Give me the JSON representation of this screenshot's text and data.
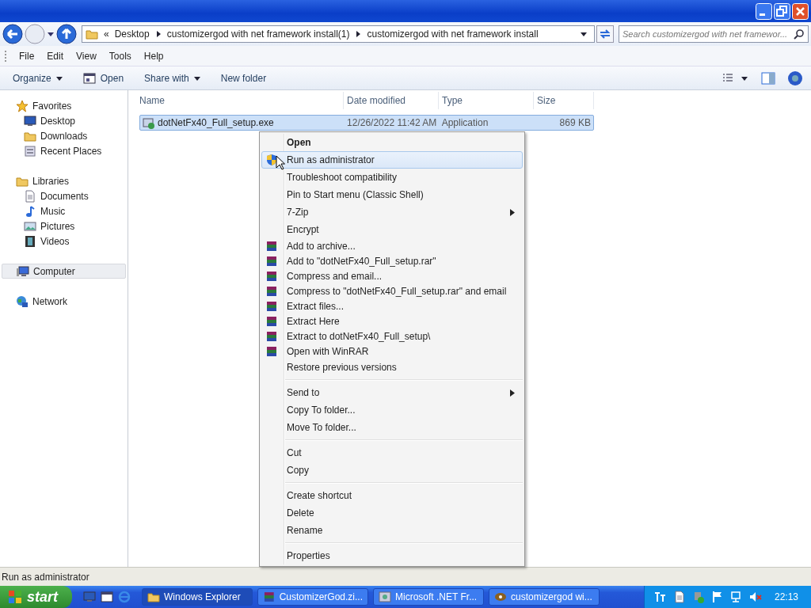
{
  "address_bar": {
    "overflow": "«",
    "crumbs": [
      "Desktop",
      "customizergod with net framework install(1)",
      "customizergod with net framework install"
    ]
  },
  "search": {
    "placeholder": "Search customizergod with net framewor..."
  },
  "menu_bar": [
    "File",
    "Edit",
    "View",
    "Tools",
    "Help"
  ],
  "command_bar": [
    {
      "label": "Organize",
      "kind": "dropdown"
    },
    {
      "label": "Open",
      "kind": "open"
    },
    {
      "label": "Share with",
      "kind": "dropdown"
    },
    {
      "label": "New folder",
      "kind": "plain"
    }
  ],
  "navigation": [
    {
      "label": "Favorites",
      "selected": false,
      "children": [
        {
          "label": "Desktop",
          "selected": false
        },
        {
          "label": "Downloads",
          "selected": false
        },
        {
          "label": "Recent Places",
          "selected": false
        }
      ]
    },
    {
      "label": "Libraries",
      "selected": false,
      "children": [
        {
          "label": "Documents",
          "selected": false
        },
        {
          "label": "Music",
          "selected": false
        },
        {
          "label": "Pictures",
          "selected": false
        },
        {
          "label": "Videos",
          "selected": false
        }
      ]
    },
    {
      "label": "Computer",
      "selected": true
    },
    {
      "label": "Network",
      "selected": false
    }
  ],
  "file_list": {
    "columns": [
      "Name",
      "Date modified",
      "Type",
      "Size"
    ],
    "rows": [
      {
        "name": "dotNetFx40_Full_setup.exe",
        "date_modified": "12/26/2022 11:42 AM",
        "type": "Application",
        "size": "869 KB",
        "selected": true
      }
    ]
  },
  "context_menu": [
    {
      "kind": "plain",
      "label": "Open",
      "default": true,
      "submenu": false,
      "selected": false
    },
    {
      "kind": "shield",
      "label": "Run as administrator",
      "default": false,
      "submenu": false,
      "selected": true
    },
    {
      "kind": "plain",
      "label": "Troubleshoot compatibility",
      "default": false,
      "submenu": false,
      "selected": false
    },
    {
      "kind": "plain",
      "label": "Pin to Start menu (Classic Shell)",
      "default": false,
      "submenu": false,
      "selected": false
    },
    {
      "kind": "plain",
      "label": "7-Zip",
      "default": false,
      "submenu": true,
      "selected": false
    },
    {
      "kind": "plain",
      "label": "Encrypt",
      "default": false,
      "submenu": false,
      "selected": false
    },
    {
      "kind": "archive",
      "label": "Add to archive...",
      "default": false,
      "submenu": false,
      "selected": false
    },
    {
      "kind": "archive",
      "label": "Add to \"dotNetFx40_Full_setup.rar\"",
      "default": false,
      "submenu": false,
      "selected": false
    },
    {
      "kind": "archive",
      "label": "Compress and email...",
      "default": false,
      "submenu": false,
      "selected": false
    },
    {
      "kind": "archive",
      "label": "Compress to \"dotNetFx40_Full_setup.rar\" and email",
      "default": false,
      "submenu": false,
      "selected": false
    },
    {
      "kind": "archive",
      "label": "Extract files...",
      "default": false,
      "submenu": false,
      "selected": false
    },
    {
      "kind": "archive",
      "label": "Extract Here",
      "default": false,
      "submenu": false,
      "selected": false
    },
    {
      "kind": "archive",
      "label": "Extract to dotNetFx40_Full_setup\\",
      "default": false,
      "submenu": false,
      "selected": false
    },
    {
      "kind": "archive",
      "label": "Open with WinRAR",
      "default": false,
      "submenu": false,
      "selected": false
    },
    {
      "kind": "plain",
      "label": "Restore previous versions",
      "default": false,
      "submenu": false,
      "selected": false
    },
    {
      "kind": "separator"
    },
    {
      "kind": "plain",
      "label": "Send to",
      "default": false,
      "submenu": true,
      "selected": false
    },
    {
      "kind": "plain",
      "label": "Copy To folder...",
      "default": false,
      "submenu": false,
      "selected": false
    },
    {
      "kind": "plain",
      "label": "Move To folder...",
      "default": false,
      "submenu": false,
      "selected": false
    },
    {
      "kind": "separator"
    },
    {
      "kind": "plain",
      "label": "Cut",
      "default": false,
      "submenu": false,
      "selected": false
    },
    {
      "kind": "plain",
      "label": "Copy",
      "default": false,
      "submenu": false,
      "selected": false
    },
    {
      "kind": "separator"
    },
    {
      "kind": "plain",
      "label": "Create shortcut",
      "default": false,
      "submenu": false,
      "selected": false
    },
    {
      "kind": "plain",
      "label": "Delete",
      "default": false,
      "submenu": false,
      "selected": false
    },
    {
      "kind": "plain",
      "label": "Rename",
      "default": false,
      "submenu": false,
      "selected": false
    },
    {
      "kind": "separator"
    },
    {
      "kind": "plain",
      "label": "Properties",
      "default": false,
      "submenu": false,
      "selected": false
    }
  ],
  "status_bar": "Run as administrator",
  "taskbar": {
    "start": "start",
    "windows": [
      {
        "label": "Windows Explorer",
        "selected": true
      },
      {
        "label": "CustomizerGod.zi...",
        "selected": false
      },
      {
        "label": "Microsoft .NET Fr...",
        "selected": false
      },
      {
        "label": "customizergod wi...",
        "selected": false
      }
    ],
    "clock": "22:13"
  }
}
